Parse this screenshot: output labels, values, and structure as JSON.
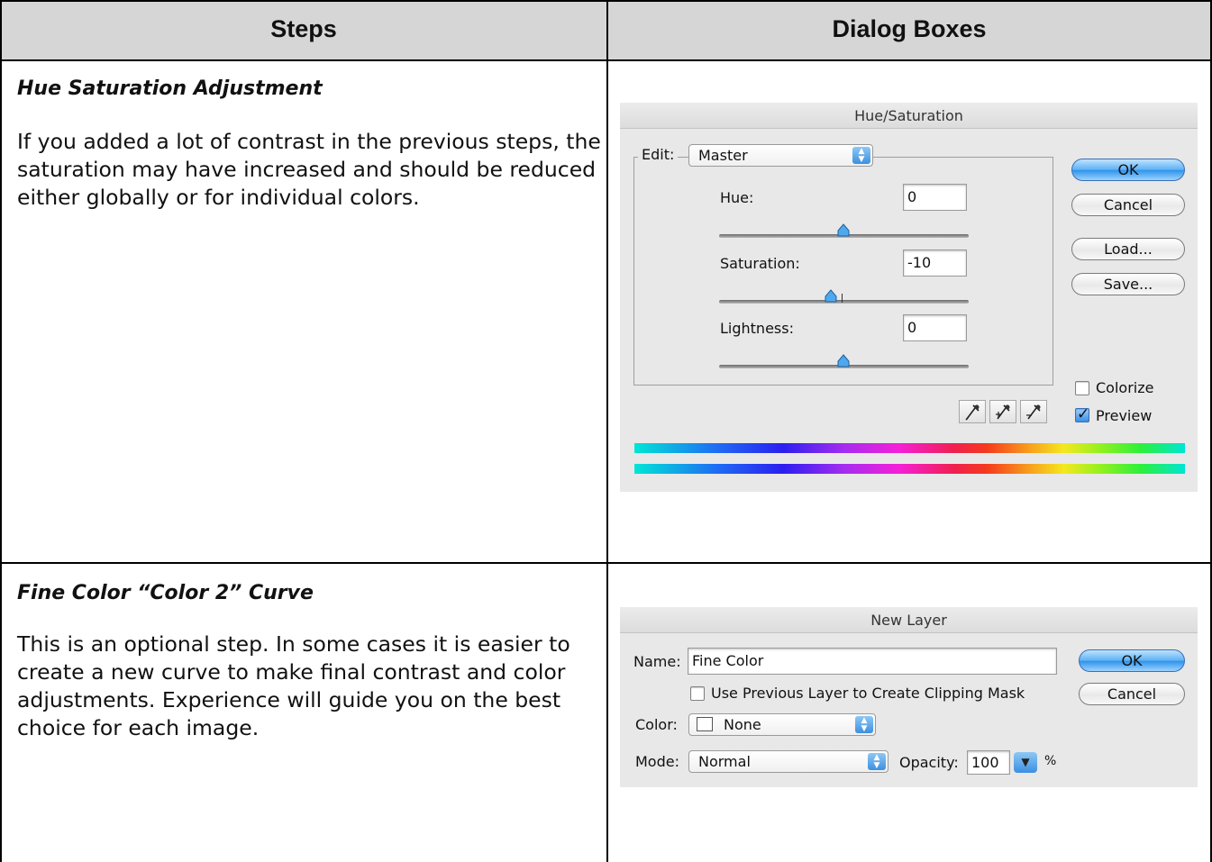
{
  "table": {
    "header_steps": "Steps",
    "header_dialogs": "Dialog Boxes"
  },
  "rows": [
    {
      "title": "Hue Saturation Adjustment",
      "body": "If you added a lot of contrast in the previous steps, the saturation may have increased and should be reduced either globally or for individual colors."
    },
    {
      "title": "Fine Color “Color 2” Curve",
      "body": "This is an optional step. In some cases it is easier to create a new curve to make final contrast and color adjustments. Experience will guide you on the best choice for each image."
    }
  ],
  "hue_saturation": {
    "title": "Hue/Saturation",
    "edit_label": "Edit:",
    "edit_value": "Master",
    "hue_label": "Hue:",
    "hue_value": "0",
    "saturation_label": "Saturation:",
    "saturation_value": "-10",
    "lightness_label": "Lightness:",
    "lightness_value": "0",
    "ok": "OK",
    "cancel": "Cancel",
    "load": "Load...",
    "save": "Save...",
    "colorize_label": "Colorize",
    "colorize_checked": false,
    "preview_label": "Preview",
    "preview_checked": true
  },
  "new_layer": {
    "title": "New Layer",
    "name_label": "Name:",
    "name_value": "Fine Color",
    "clipping_label": "Use Previous Layer to Create Clipping Mask",
    "clipping_checked": false,
    "color_label": "Color:",
    "color_value": "None",
    "mode_label": "Mode:",
    "mode_value": "Normal",
    "opacity_label": "Opacity:",
    "opacity_value": "100",
    "opacity_unit": "%",
    "ok": "OK",
    "cancel": "Cancel"
  },
  "icons": [
    "eyedropper-icon",
    "eyedropper-plus-icon",
    "eyedropper-minus-icon",
    "popup-arrows-icon",
    "checkmark-icon",
    "slider-thumb-icon"
  ],
  "colors": {
    "header_bg": "#d6d6d6",
    "dialog_bg": "#e8e8e8",
    "default_button": "#4aa3f0"
  }
}
